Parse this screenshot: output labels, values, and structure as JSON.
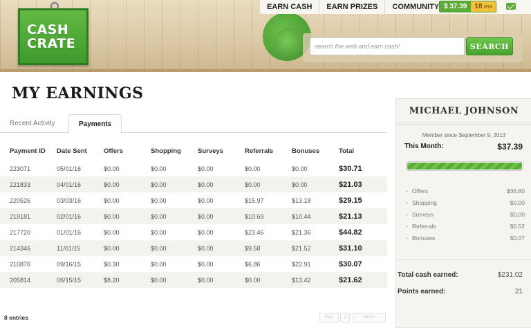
{
  "header": {
    "logo": [
      "CASH",
      "CRATE"
    ],
    "nav": [
      "EARN CASH",
      "EARN PRIZES",
      "COMMUNITY"
    ],
    "balance_cash": "$ 37.39",
    "balance_points": "18",
    "balance_points_unit": "PTS",
    "search_placeholder": "search the web and earn cash!",
    "search_button": "SEARCH"
  },
  "main": {
    "title": "MY EARNINGS",
    "tabs": [
      "Recent Activity",
      "Payments"
    ],
    "active_tab": "Payments",
    "columns": [
      "Payment ID",
      "Date Sent",
      "Offers",
      "Shopping",
      "Surveys",
      "Referrals",
      "Bonuses",
      "Total"
    ],
    "rows": [
      [
        "223071",
        "05/01/16",
        "$0.00",
        "$0.00",
        "$0.00",
        "$0.00",
        "$0.00",
        "$30.71"
      ],
      [
        "221833",
        "04/01/16",
        "$0.00",
        "$0.00",
        "$0.00",
        "$0.00",
        "$0.00",
        "$21.03"
      ],
      [
        "220526",
        "03/03/16",
        "$0.00",
        "$0.00",
        "$0.00",
        "$15.97",
        "$13.18",
        "$29.15"
      ],
      [
        "219181",
        "02/01/16",
        "$0.00",
        "$0.00",
        "$0.00",
        "$10.69",
        "$10.44",
        "$21.13"
      ],
      [
        "217720",
        "01/01/16",
        "$0.00",
        "$0.00",
        "$0.00",
        "$23.46",
        "$21.36",
        "$44.82"
      ],
      [
        "214346",
        "11/01/15",
        "$0.00",
        "$0.00",
        "$0.00",
        "$9.58",
        "$21.52",
        "$31.10"
      ],
      [
        "210876",
        "09/16/15",
        "$0.30",
        "$0.00",
        "$0.00",
        "$6.86",
        "$22.91",
        "$30.07"
      ],
      [
        "205814",
        "06/15/15",
        "$8.20",
        "$0.00",
        "$0.00",
        "$0.00",
        "$13.42",
        "$21.62"
      ]
    ],
    "entries": "8 entries",
    "pager": {
      "prev": "Prev",
      "page": "1",
      "next": "NEXT"
    }
  },
  "sidebar": {
    "name": "MICHAEL JOHNSON",
    "member_since": "Member since September 9, 2013",
    "month_label": "This Month:",
    "month_value": "$37.39",
    "progress_fraction": 1.0,
    "breakdown": [
      {
        "label": "Offers",
        "value": "$36.80"
      },
      {
        "label": "Shopping",
        "value": "$0.00"
      },
      {
        "label": "Surveys",
        "value": "$0.00"
      },
      {
        "label": "Referrals",
        "value": "$0.52"
      },
      {
        "label": "Bonuses",
        "value": "$0.07"
      }
    ],
    "total_cash_label": "Total cash earned:",
    "total_cash_value": "$231.02",
    "points_label": "Points earned:",
    "points_value": "21"
  },
  "colors": {
    "brand_green": "#5aac37",
    "points_yellow": "#f3c23c",
    "wood": "#dcc9a5"
  }
}
